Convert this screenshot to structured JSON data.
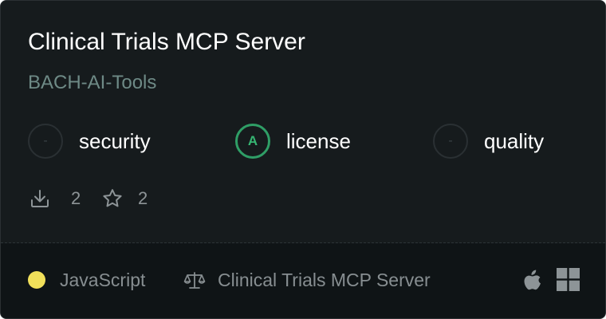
{
  "card": {
    "title": "Clinical Trials MCP Server",
    "author": "BACH-AI-Tools",
    "scores": [
      {
        "grade": "-",
        "label": "security",
        "state": "none"
      },
      {
        "grade": "A",
        "label": "license",
        "state": "good"
      },
      {
        "grade": "-",
        "label": "quality",
        "state": "none"
      }
    ],
    "stats": {
      "downloads": "2",
      "downloads_icon": "download-icon",
      "stars": "2",
      "stars_icon": "star-icon"
    },
    "footer": {
      "language": "JavaScript",
      "language_color": "#f1e05a",
      "license_icon": "scale-icon",
      "license": "Clinical Trials MCP Server",
      "platforms": [
        "apple-icon",
        "windows-icon"
      ]
    }
  },
  "colors": {
    "card_background": "#161b1d",
    "footer_background": "#0f1416",
    "author_text": "#6e8a86",
    "good_grade": "#2f9e66"
  }
}
